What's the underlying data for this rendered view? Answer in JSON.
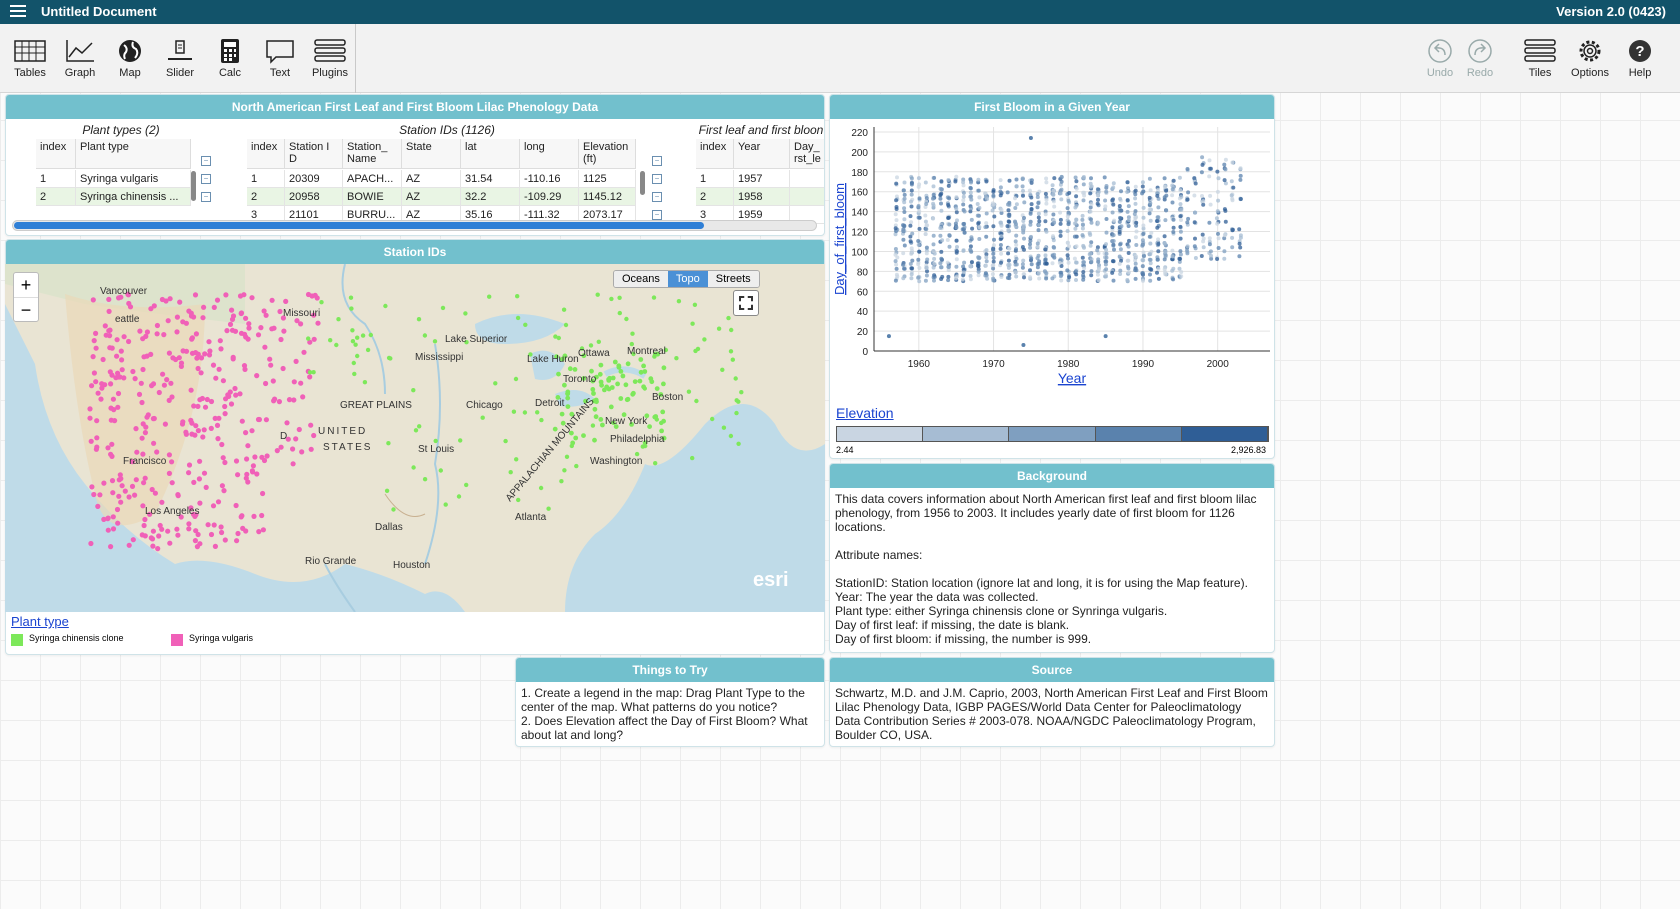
{
  "app": {
    "title": "Untitled Document",
    "version": "Version 2.0 (0423)"
  },
  "toolbar": {
    "left": [
      "Tables",
      "Graph",
      "Map",
      "Slider",
      "Calc",
      "Text",
      "Plugins"
    ],
    "right": [
      "Undo",
      "Redo",
      "Tiles",
      "Options",
      "Help"
    ]
  },
  "table_tile": {
    "title": "North American First Leaf and First Bloom Lilac Phenology Data",
    "plant_types": {
      "caption": "Plant types (2)",
      "headers": [
        "index",
        "Plant type"
      ],
      "rows": [
        [
          "1",
          "Syringa vulgaris"
        ],
        [
          "2",
          "Syringa chinensis ..."
        ]
      ]
    },
    "stations": {
      "caption": "Station IDs (1126)",
      "headers": [
        "index",
        "Station I D",
        "Station_ Name",
        "State",
        "lat",
        "long",
        "Elevation (ft)"
      ],
      "rows": [
        [
          "1",
          "20309",
          "APACH...",
          "AZ",
          "31.54",
          "-110.16",
          "1125"
        ],
        [
          "2",
          "20958",
          "BOWIE",
          "AZ",
          "32.2",
          "-109.29",
          "1145.12"
        ],
        [
          "3",
          "21101",
          "BURRU...",
          "AZ",
          "35.16",
          "-111.32",
          "2073.17"
        ]
      ]
    },
    "bloom": {
      "caption": "First leaf and first bloon",
      "headers": [
        "index",
        "Year",
        "Day_ rst_le"
      ],
      "rows": [
        [
          "1",
          "1957",
          ""
        ],
        [
          "2",
          "1958",
          ""
        ],
        [
          "3",
          "1959",
          ""
        ]
      ]
    }
  },
  "map_tile": {
    "title": "Station IDs",
    "basemaps": [
      "Oceans",
      "Topo",
      "Streets"
    ],
    "selected_basemap": "Topo",
    "zoom_in": "+",
    "zoom_out": "−",
    "legend_title": "Plant type",
    "legend_items": [
      {
        "label": "Syringa chinensis clone",
        "color": "#7de85a"
      },
      {
        "label": "Syringa vulgaris",
        "color": "#f060b8"
      }
    ],
    "labels": [
      "Vancouver",
      "eattle",
      "Missouri",
      "Lake Superior",
      "Ottawa",
      "Montreal",
      "Lake Huron",
      "Toronto",
      "GREAT PLAINS",
      "Chicago",
      "Detroit",
      "Boston",
      "New York",
      "Philadelphia",
      "Washington",
      "St Louis",
      "UNITED",
      "STATES",
      "Dallas",
      "Atlanta",
      "Houston",
      "Los Angeles",
      "Francisco",
      "Rio Grande",
      "APPALACHIAN MOUNTAINS",
      "Mississippi",
      "D"
    ],
    "attribution": "esri"
  },
  "graph_tile": {
    "title": "First Bloom in a Given Year",
    "legend_title": "Elevation",
    "legend_min": "2.44",
    "legend_max": "2,926.83",
    "legend_colors": [
      "#c9d5e2",
      "#a6bcd3",
      "#7f9fc0",
      "#5a82ad",
      "#2f5e96"
    ]
  },
  "chart_data": {
    "type": "scatter",
    "xlabel": "Year",
    "ylabel": "Day_of_first_bloom",
    "x_ticks": [
      "1960",
      "1970",
      "1980",
      "1990",
      "2000"
    ],
    "y_ticks": [
      "0",
      "20",
      "40",
      "60",
      "80",
      "100",
      "120",
      "140",
      "160",
      "180",
      "200",
      "220"
    ],
    "xlim": [
      1954,
      2007
    ],
    "ylim": [
      0,
      225
    ],
    "year_range": [
      1957,
      2003
    ],
    "outliers": [
      {
        "x": 1975,
        "y": 214
      },
      {
        "x": 1956,
        "y": 15
      },
      {
        "x": 1974,
        "y": 6
      },
      {
        "x": 1985,
        "y": 15
      }
    ]
  },
  "background_tile": {
    "title": "Background",
    "text": "This data covers information about North American first leaf and first bloom lilac phenology, from 1956 to 2003. It includes yearly date of first bloom for 1126 locations.\n\nAttribute names:\n\nStationID: Station location (ignore lat and long, it is for using the Map feature).\nYear: The year the data was collected.\nPlant type: either Syringa chinensis clone or Synringa vulgaris.\nDay of first leaf: if missing, the date is blank.\nDay of first bloom: if missing, the number is 999."
  },
  "things_tile": {
    "title": "Things to Try",
    "text": "1. Create a legend in the map: Drag Plant Type to the center of the map. What patterns do you notice?\n2. Does Elevation affect the Day of First Bloom? What about lat and long?"
  },
  "source_tile": {
    "title": "Source",
    "text": "Schwartz, M.D. and J.M. Caprio, 2003, North American First Leaf and First Bloom Lilac Phenology Data, IGBP PAGES/World Data Center for Paleoclimatology Data Contribution Series # 2003-078. NOAA/NGDC Paleoclimatology Program, Boulder CO, USA."
  }
}
